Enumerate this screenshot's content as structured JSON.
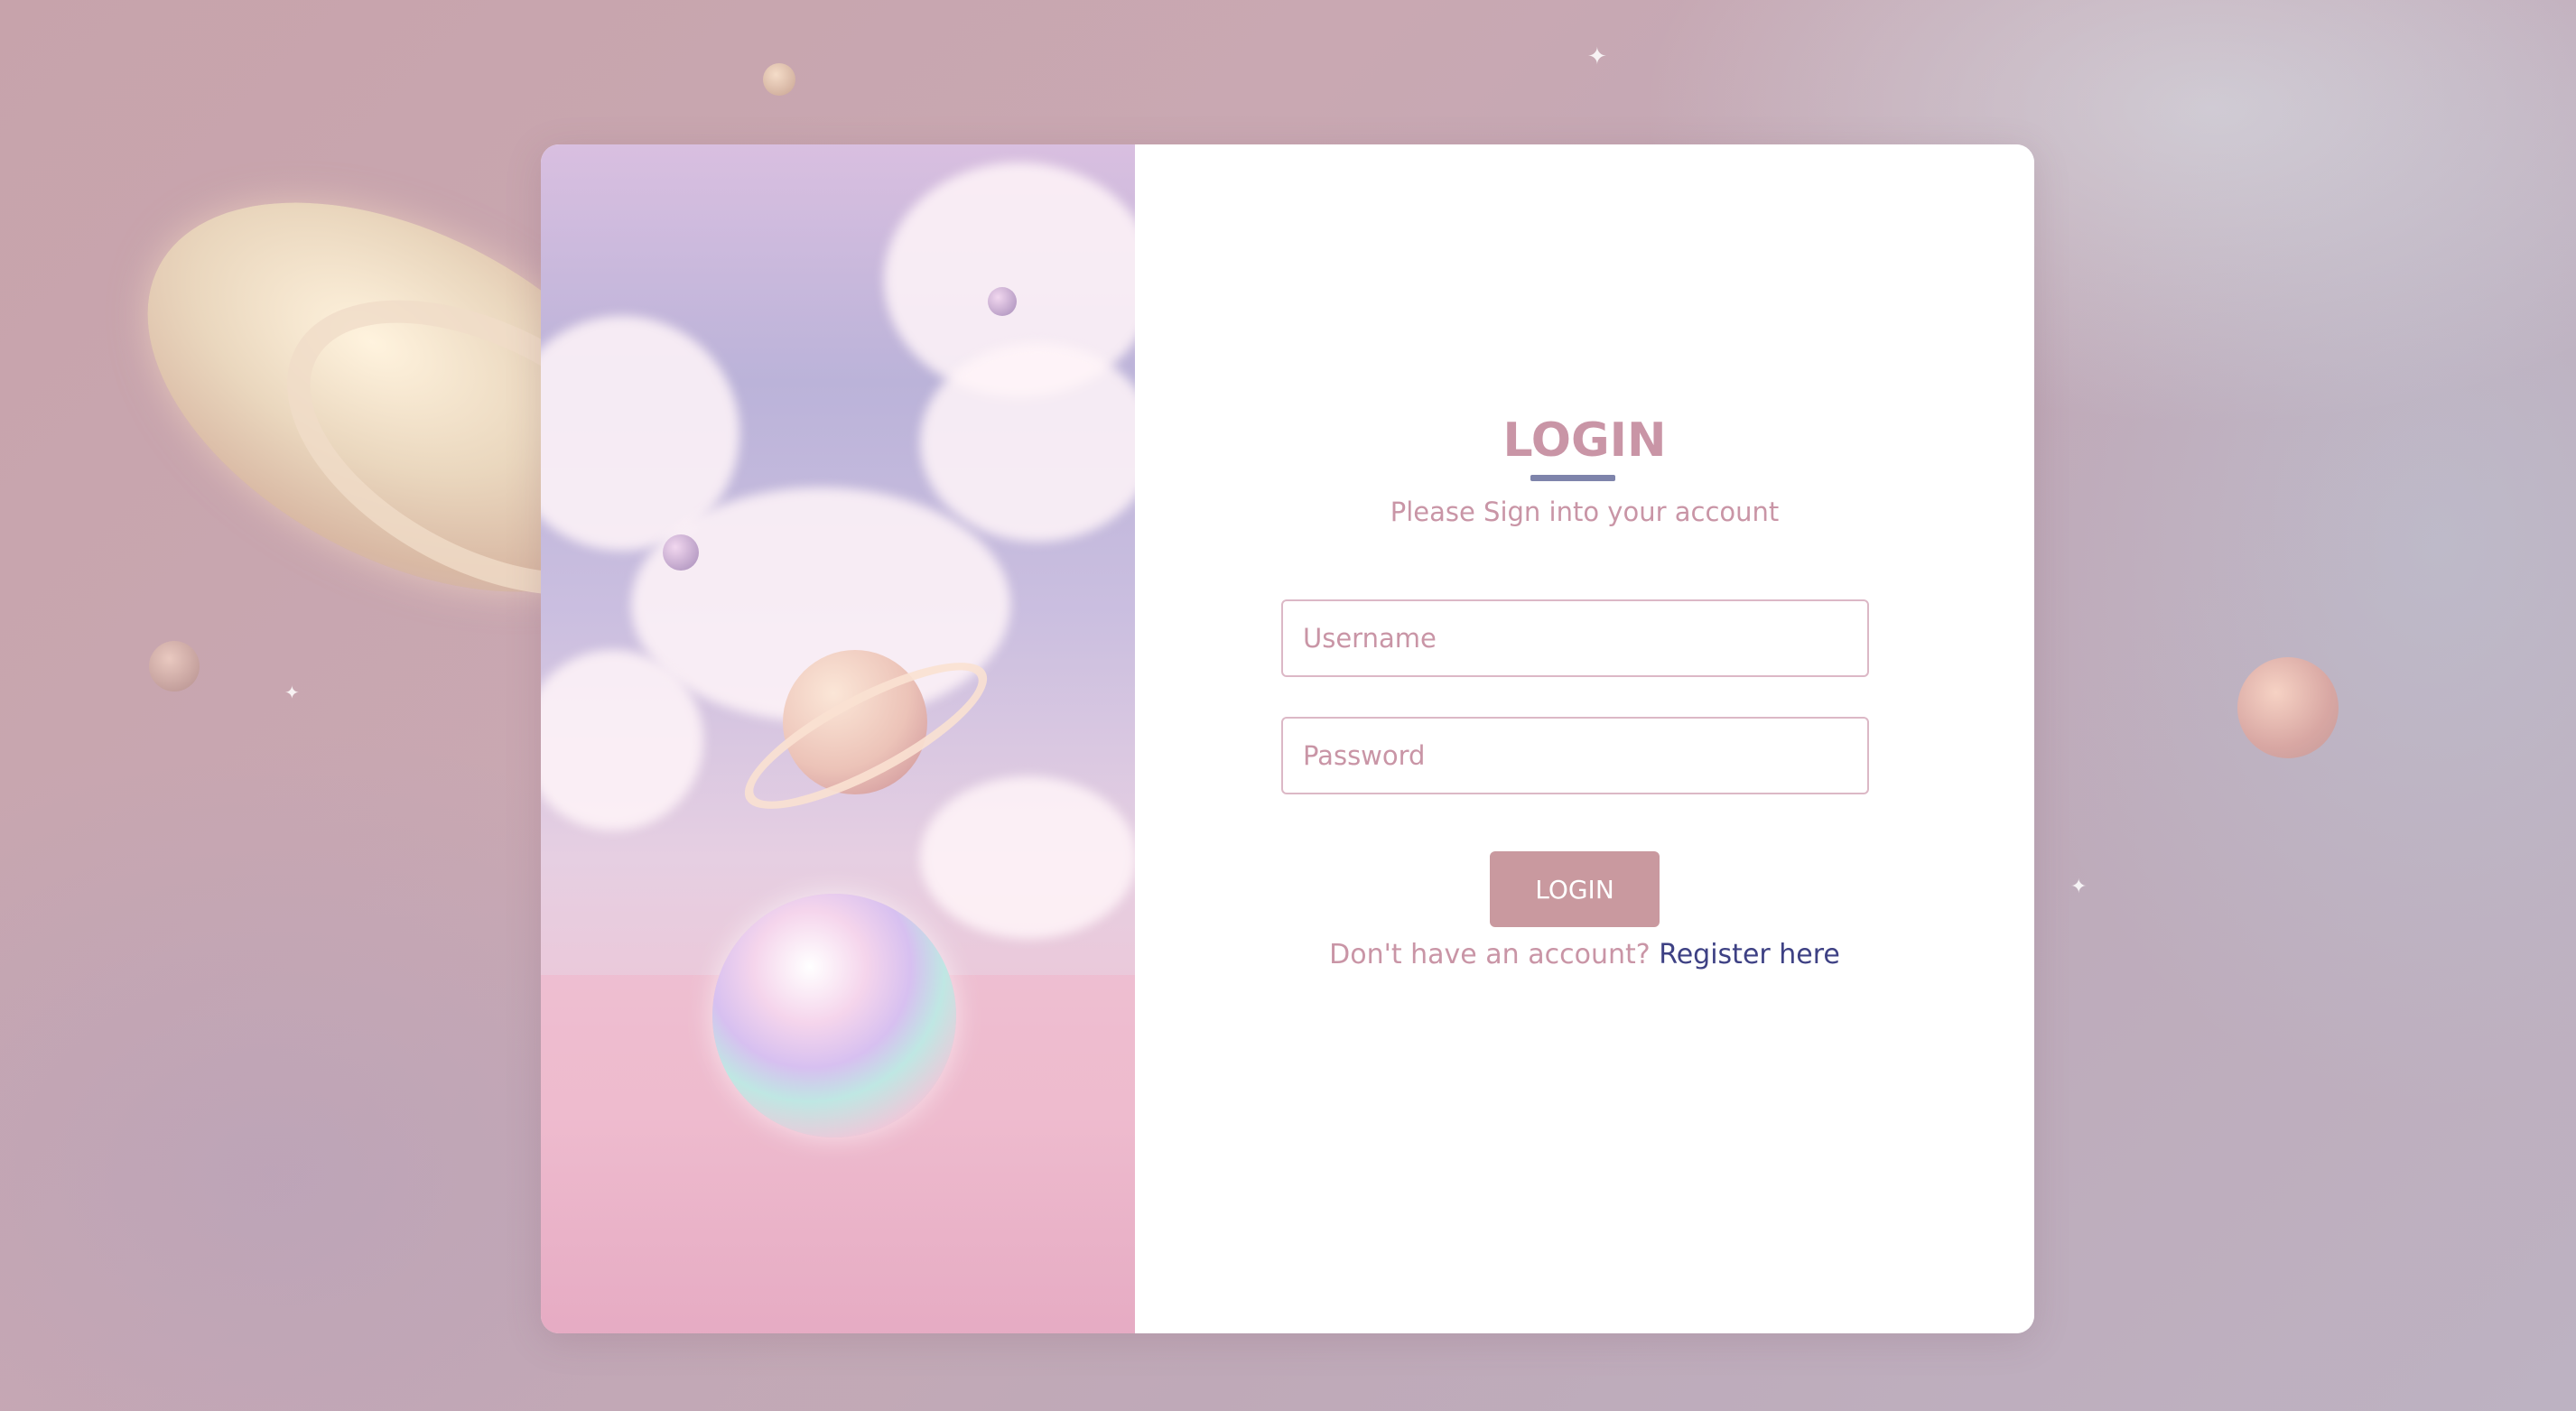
{
  "login": {
    "title": "LOGIN",
    "subtitle": "Please Sign into your account",
    "username_placeholder": "Username",
    "password_placeholder": "Password",
    "submit_label": "LOGIN",
    "register_prompt": "Don't have an account?",
    "register_link": "Register here"
  },
  "colors": {
    "accent_pink": "#c995a6",
    "button_bg": "#c9999f",
    "underline": "#7e84ab",
    "link": "#3e4184"
  }
}
